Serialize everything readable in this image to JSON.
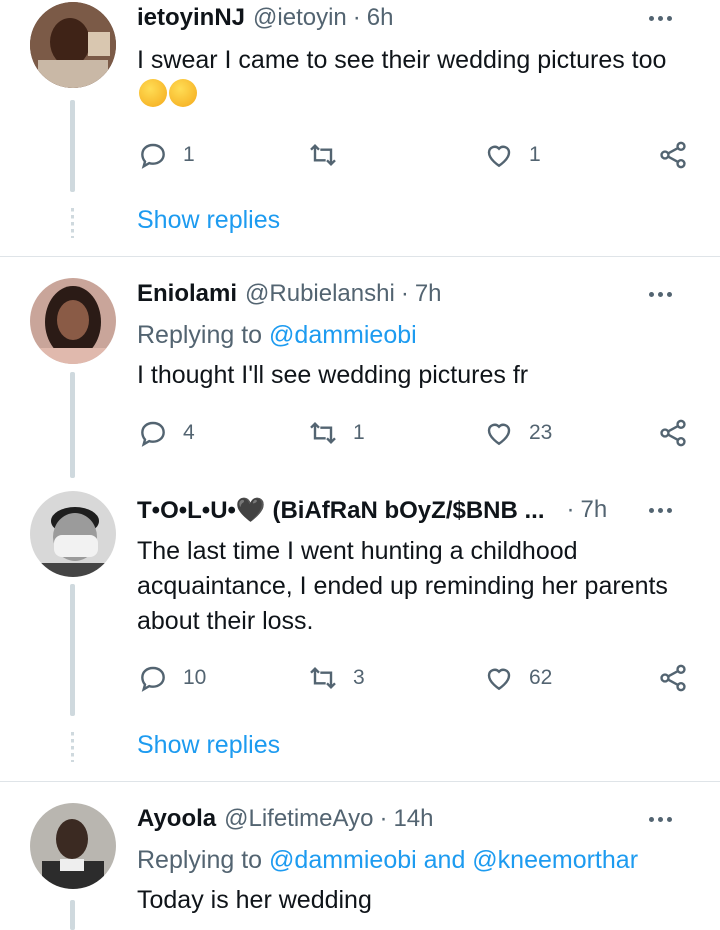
{
  "tweets": [
    {
      "name": "ietoyinNJ",
      "handle": "@ietoyin",
      "time": "6h",
      "replying_to": null,
      "text": "I swear I came to see their wedding pictures too",
      "emojis": [
        "rolling-on-floor-laughing-emoji",
        "rolling-on-floor-laughing-emoji"
      ],
      "replies": "1",
      "retweets": "",
      "likes": "1",
      "show_replies": "Show replies"
    },
    {
      "name": "Eniolami",
      "handle": "@Rubielanshi",
      "time": "7h",
      "replying_prefix": "Replying to",
      "replying_mentions": "@dammieobi",
      "text": "I thought I'll see wedding pictures fr",
      "replies": "4",
      "retweets": "1",
      "likes": "23"
    },
    {
      "name": "T•O•L•U•🖤 (BiAfRaN bOyZ/$BNB ...",
      "handle": "",
      "time": "7h",
      "text": "The last time I went hunting a childhood acquaintance, I ended up reminding her parents about their loss.",
      "replies": "10",
      "retweets": "3",
      "likes": "62",
      "show_replies": "Show replies"
    },
    {
      "name": "Ayoola",
      "handle": "@LifetimeAyo",
      "time": "14h",
      "replying_prefix": "Replying to",
      "replying_mentions": "@dammieobi and @kneemorthar",
      "text": "Today is her wedding"
    }
  ],
  "colors": {
    "accent": "#1d9bf0",
    "secondary_text": "#536471",
    "thread_line": "#cfd9de"
  }
}
